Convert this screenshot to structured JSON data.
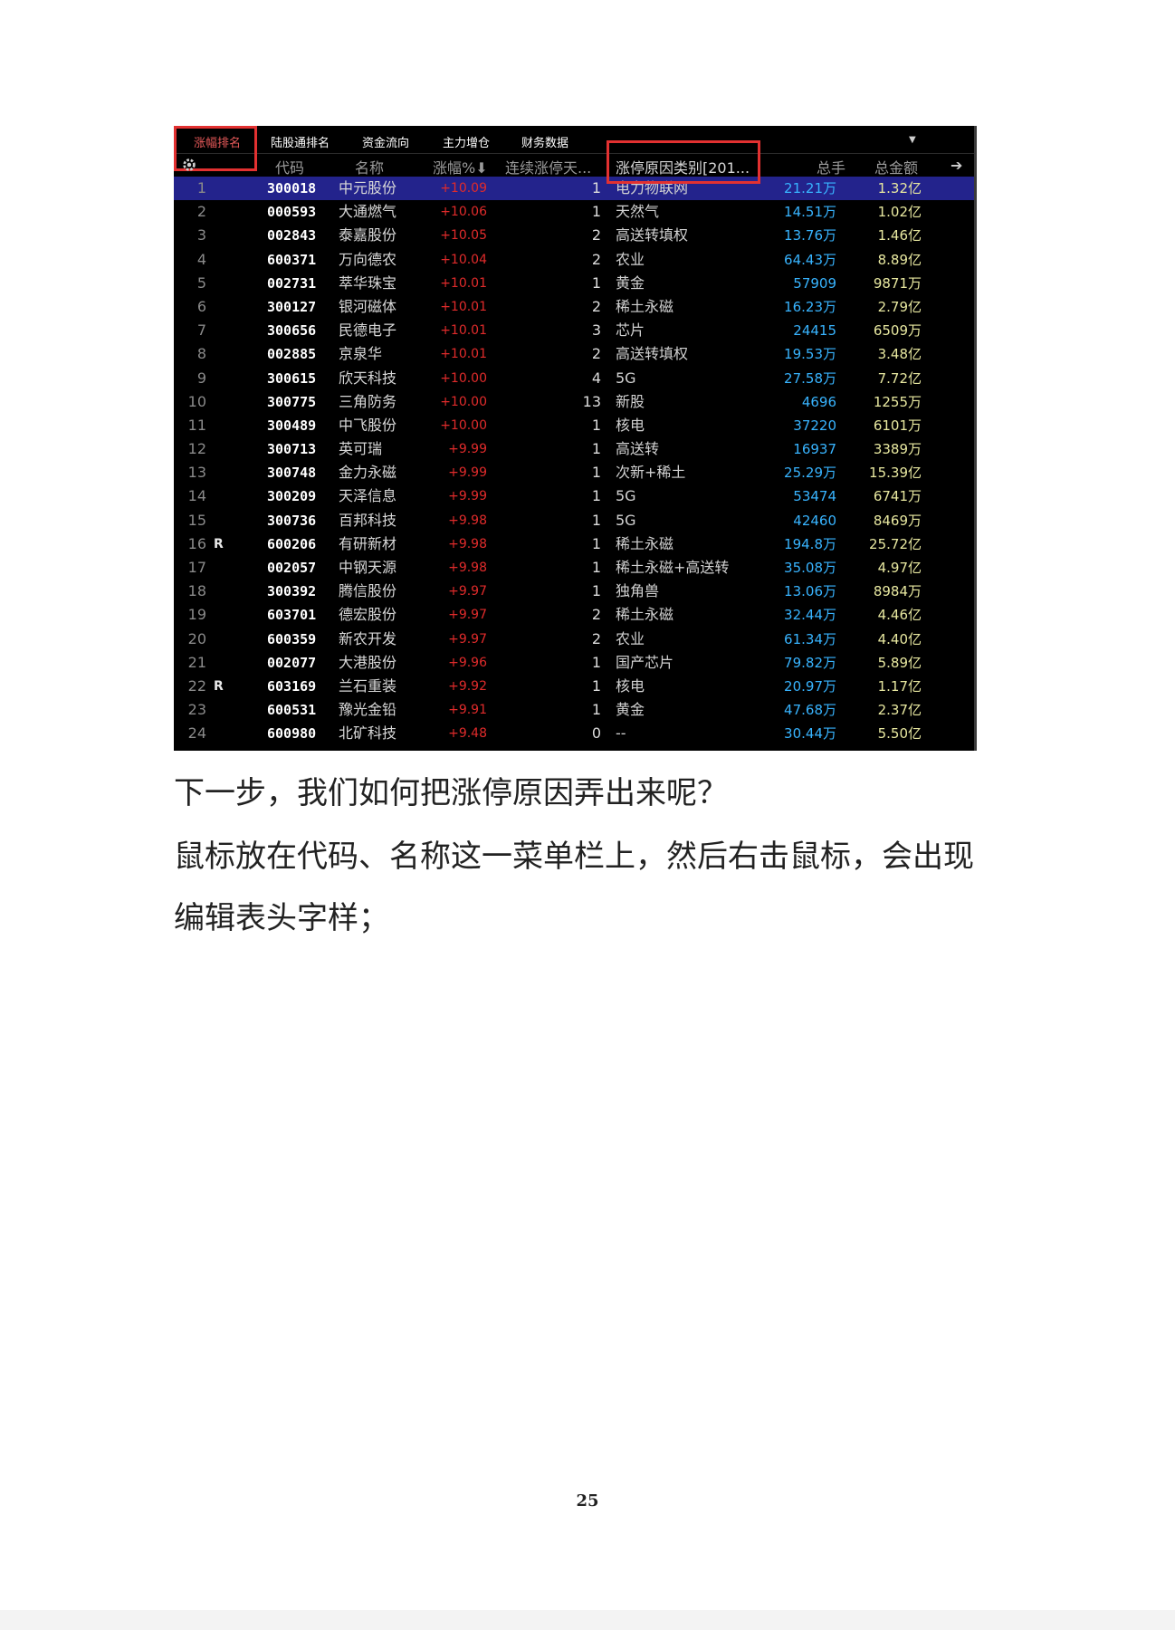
{
  "screenshot": {
    "tabs": [
      "涨幅排名",
      "陆股通排名",
      "资金流向",
      "主力增仓",
      "财务数据"
    ],
    "columns": {
      "code": "代码",
      "name": "名称",
      "pct": "涨幅%",
      "limit_days": "连续涨停天...",
      "reason": "涨停原因类别[201...",
      "volume": "总手",
      "amount": "总金额"
    },
    "rows": [
      {
        "idx": "1",
        "flag": "",
        "code": "300018",
        "name": "中元股份",
        "pct": "+10.09",
        "days": "1",
        "reason": "电力物联网",
        "vol": "21.21万",
        "amt": "1.32亿"
      },
      {
        "idx": "2",
        "flag": "",
        "code": "000593",
        "name": "大通燃气",
        "pct": "+10.06",
        "days": "1",
        "reason": "天然气",
        "vol": "14.51万",
        "amt": "1.02亿"
      },
      {
        "idx": "3",
        "flag": "",
        "code": "002843",
        "name": "泰嘉股份",
        "pct": "+10.05",
        "days": "2",
        "reason": "高送转填权",
        "vol": "13.76万",
        "amt": "1.46亿"
      },
      {
        "idx": "4",
        "flag": "",
        "code": "600371",
        "name": "万向德农",
        "pct": "+10.04",
        "days": "2",
        "reason": "农业",
        "vol": "64.43万",
        "amt": "8.89亿"
      },
      {
        "idx": "5",
        "flag": "",
        "code": "002731",
        "name": "萃华珠宝",
        "pct": "+10.01",
        "days": "1",
        "reason": "黄金",
        "vol": "57909",
        "amt": "9871万"
      },
      {
        "idx": "6",
        "flag": "",
        "code": "300127",
        "name": "银河磁体",
        "pct": "+10.01",
        "days": "2",
        "reason": "稀土永磁",
        "vol": "16.23万",
        "amt": "2.79亿"
      },
      {
        "idx": "7",
        "flag": "",
        "code": "300656",
        "name": "民德电子",
        "pct": "+10.01",
        "days": "3",
        "reason": "芯片",
        "vol": "24415",
        "amt": "6509万"
      },
      {
        "idx": "8",
        "flag": "",
        "code": "002885",
        "name": "京泉华",
        "pct": "+10.01",
        "days": "2",
        "reason": "高送转填权",
        "vol": "19.53万",
        "amt": "3.48亿"
      },
      {
        "idx": "9",
        "flag": "",
        "code": "300615",
        "name": "欣天科技",
        "pct": "+10.00",
        "days": "4",
        "reason": "5G",
        "vol": "27.58万",
        "amt": "7.72亿"
      },
      {
        "idx": "10",
        "flag": "",
        "code": "300775",
        "name": "三角防务",
        "pct": "+10.00",
        "days": "13",
        "reason": "新股",
        "vol": "4696",
        "amt": "1255万"
      },
      {
        "idx": "11",
        "flag": "",
        "code": "300489",
        "name": "中飞股份",
        "pct": "+10.00",
        "days": "1",
        "reason": "核电",
        "vol": "37220",
        "amt": "6101万"
      },
      {
        "idx": "12",
        "flag": "",
        "code": "300713",
        "name": "英可瑞",
        "pct": "+9.99",
        "days": "1",
        "reason": "高送转",
        "vol": "16937",
        "amt": "3389万"
      },
      {
        "idx": "13",
        "flag": "",
        "code": "300748",
        "name": "金力永磁",
        "pct": "+9.99",
        "days": "1",
        "reason": "次新+稀土",
        "vol": "25.29万",
        "amt": "15.39亿"
      },
      {
        "idx": "14",
        "flag": "",
        "code": "300209",
        "name": "天泽信息",
        "pct": "+9.99",
        "days": "1",
        "reason": "5G",
        "vol": "53474",
        "amt": "6741万"
      },
      {
        "idx": "15",
        "flag": "",
        "code": "300736",
        "name": "百邦科技",
        "pct": "+9.98",
        "days": "1",
        "reason": "5G",
        "vol": "42460",
        "amt": "8469万"
      },
      {
        "idx": "16",
        "flag": "R",
        "code": "600206",
        "name": "有研新材",
        "pct": "+9.98",
        "days": "1",
        "reason": "稀土永磁",
        "vol": "194.8万",
        "amt": "25.72亿"
      },
      {
        "idx": "17",
        "flag": "",
        "code": "002057",
        "name": "中钢天源",
        "pct": "+9.98",
        "days": "1",
        "reason": "稀土永磁+高送转",
        "vol": "35.08万",
        "amt": "4.97亿"
      },
      {
        "idx": "18",
        "flag": "",
        "code": "300392",
        "name": "腾信股份",
        "pct": "+9.97",
        "days": "1",
        "reason": "独角兽",
        "vol": "13.06万",
        "amt": "8984万"
      },
      {
        "idx": "19",
        "flag": "",
        "code": "603701",
        "name": "德宏股份",
        "pct": "+9.97",
        "days": "2",
        "reason": "稀土永磁",
        "vol": "32.44万",
        "amt": "4.46亿"
      },
      {
        "idx": "20",
        "flag": "",
        "code": "600359",
        "name": "新农开发",
        "pct": "+9.97",
        "days": "2",
        "reason": "农业",
        "vol": "61.34万",
        "amt": "4.40亿"
      },
      {
        "idx": "21",
        "flag": "",
        "code": "002077",
        "name": "大港股份",
        "pct": "+9.96",
        "days": "1",
        "reason": "国产芯片",
        "vol": "79.82万",
        "amt": "5.89亿"
      },
      {
        "idx": "22",
        "flag": "R",
        "code": "603169",
        "name": "兰石重装",
        "pct": "+9.92",
        "days": "1",
        "reason": "核电",
        "vol": "20.97万",
        "amt": "1.17亿"
      },
      {
        "idx": "23",
        "flag": "",
        "code": "600531",
        "name": "豫光金铅",
        "pct": "+9.91",
        "days": "1",
        "reason": "黄金",
        "vol": "47.68万",
        "amt": "2.37亿"
      },
      {
        "idx": "24",
        "flag": "",
        "code": "600980",
        "name": "北矿科技",
        "pct": "+9.48",
        "days": "0",
        "reason": "--",
        "vol": "30.44万",
        "amt": "5.50亿"
      }
    ]
  },
  "paragraphs": {
    "p1": "下一步，我们如何把涨停原因弄出来呢？",
    "p2": "鼠标放在代码、名称这一菜单栏上，然后右击鼠标，会出现",
    "p3": "编辑表头字样；"
  },
  "page_number": "25",
  "colors": {
    "highlight_box": "#e23131",
    "selected_row": "#23238c",
    "pct_red": "#e02b2b",
    "volume_blue": "#38b4ff"
  }
}
